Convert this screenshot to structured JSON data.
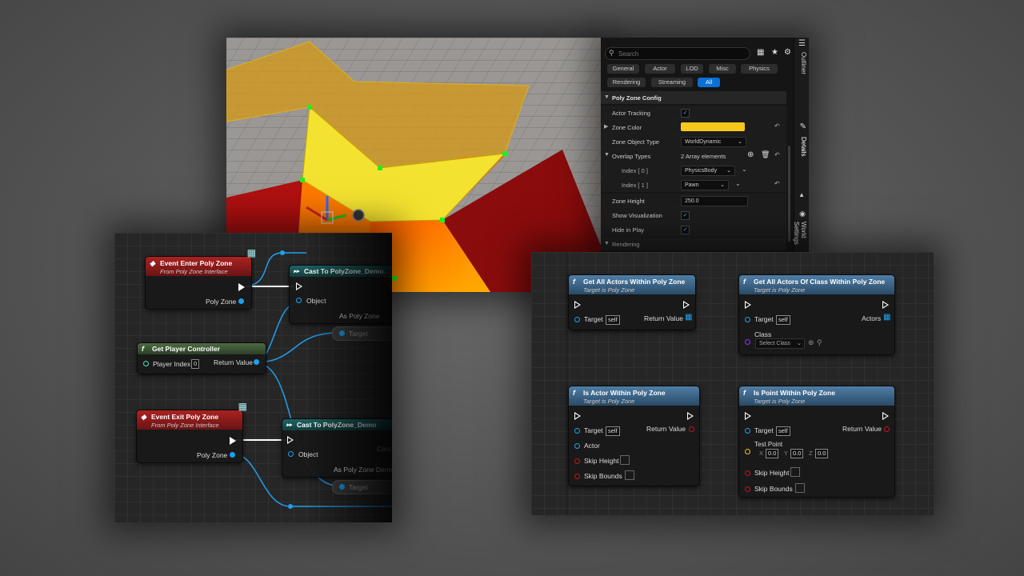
{
  "details": {
    "search_placeholder": "Search",
    "side_tabs": [
      "Outliner",
      "Details",
      "World Settings"
    ],
    "filter_tabs": [
      "General",
      "Actor",
      "LOD",
      "Misc",
      "Physics",
      "Rendering",
      "Streaming",
      "All"
    ],
    "active_filter": "All",
    "section_title": "Poly Zone Config",
    "rows": {
      "actor_tracking": {
        "label": "Actor Tracking",
        "checked": true
      },
      "zone_color": {
        "label": "Zone Color",
        "color": "#f7c81a"
      },
      "zone_object_type": {
        "label": "Zone Object Type",
        "value": "WorldDynamic"
      },
      "overlap_types": {
        "label": "Overlap Types",
        "value": "2 Array elements"
      },
      "index0": {
        "label": "Index [ 0 ]",
        "value": "PhysicsBody"
      },
      "index1": {
        "label": "Index [ 1 ]",
        "value": "Pawn"
      },
      "zone_height": {
        "label": "Zone Height",
        "value": "250.0"
      },
      "show_visualization": {
        "label": "Show Visualization",
        "checked": true
      },
      "hide_in_play": {
        "label": "Hide in Play",
        "checked": true
      }
    },
    "next_section": "Rendering"
  },
  "graph_left": {
    "event_enter": {
      "title": "Event Enter Poly Zone",
      "subtitle": "From Poly Zone Interface",
      "pin": "Poly Zone"
    },
    "cast1": {
      "title": "Cast To PolyZone_Demo",
      "pin_in": "Object",
      "pin_out": "As Poly Zone",
      "target": "Target"
    },
    "get_pc": {
      "title": "Get Player Controller",
      "pin_in": "Player Index",
      "pin_in_value": "0",
      "pin_out": "Return Value"
    },
    "event_exit": {
      "title": "Event Exit Poly Zone",
      "subtitle": "From Poly Zone Interface",
      "pin": "Poly Zone"
    },
    "cast2": {
      "title": "Cast To PolyZone_Demo",
      "pin_in": "Object",
      "pin_out": "As Poly Zone Demo",
      "target": "Target",
      "extra": "Cast"
    }
  },
  "graph_right": {
    "get_all": {
      "title": "Get All Actors Within Poly Zone",
      "subtitle": "Target is Poly Zone",
      "target": "Target",
      "self": "self",
      "out": "Return Value"
    },
    "get_all_class": {
      "title": "Get All Actors Of Class Within Poly Zone",
      "subtitle": "Target is Poly Zone",
      "target": "Target",
      "self": "self",
      "out": "Actors",
      "class_label": "Class",
      "class_value": "Select Class"
    },
    "is_actor": {
      "title": "Is Actor Within Poly Zone",
      "subtitle": "Target is Poly Zone",
      "target": "Target",
      "self": "self",
      "actor": "Actor",
      "skip_height": "Skip Height",
      "skip_bounds": "Skip Bounds",
      "out": "Return Value"
    },
    "is_point": {
      "title": "Is Point Within Poly Zone",
      "subtitle": "Target is Poly Zone",
      "target": "Target",
      "self": "self",
      "test_point": "Test Point",
      "x_label": "X",
      "x": "0.0",
      "y_label": "Y",
      "y": "0.0",
      "z_label": "Z",
      "z": "0.0",
      "skip_height": "Skip Height",
      "skip_bounds": "Skip Bounds",
      "out": "Return Value"
    }
  },
  "colors": {
    "accent": "#0a70d6",
    "zone_yellow": "#f7c81a",
    "event_red": "#a22222",
    "function_blue": "#4f7ea6"
  }
}
